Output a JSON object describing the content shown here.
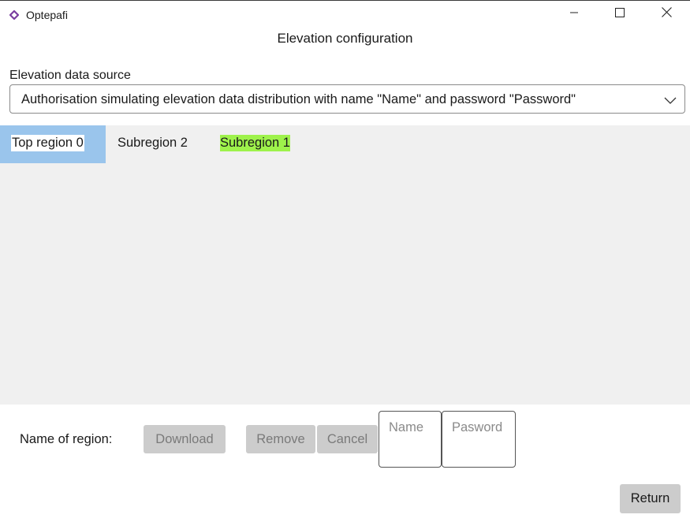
{
  "window": {
    "app_name": "Optepafi",
    "icon": "optepafi-logo-icon",
    "controls": {
      "minimize": "minimize-icon",
      "maximize": "maximize-icon",
      "close": "close-icon"
    }
  },
  "dialog": {
    "title": "Elevation configuration"
  },
  "source": {
    "label": "Elevation data source",
    "selected": "Authorisation simulating elevation data distribution with name \"Name\" and password \"Password\"",
    "chevron": "chevron-down-icon"
  },
  "regions": {
    "tabs": [
      {
        "label": "Top region 0",
        "state": "selected",
        "color": "#9ac5ec"
      },
      {
        "label": "Subregion 2",
        "state": "normal"
      },
      {
        "label": "Subregion 1",
        "state": "highlighted",
        "color": "#9ef24b"
      }
    ]
  },
  "bottom": {
    "region_name_label": "Name of region:",
    "download_label": "Download",
    "remove_label": "Remove",
    "cancel_label": "Cancel",
    "name_placeholder": "Name",
    "password_placeholder": "Pasword",
    "return_label": "Return"
  },
  "colors": {
    "panel_background": "#f0f0f0",
    "disabled_button": "#cccccc",
    "selected_tab": "#9ac5ec",
    "highlight": "#9ef24b",
    "app_icon": "#7b3fa0"
  }
}
